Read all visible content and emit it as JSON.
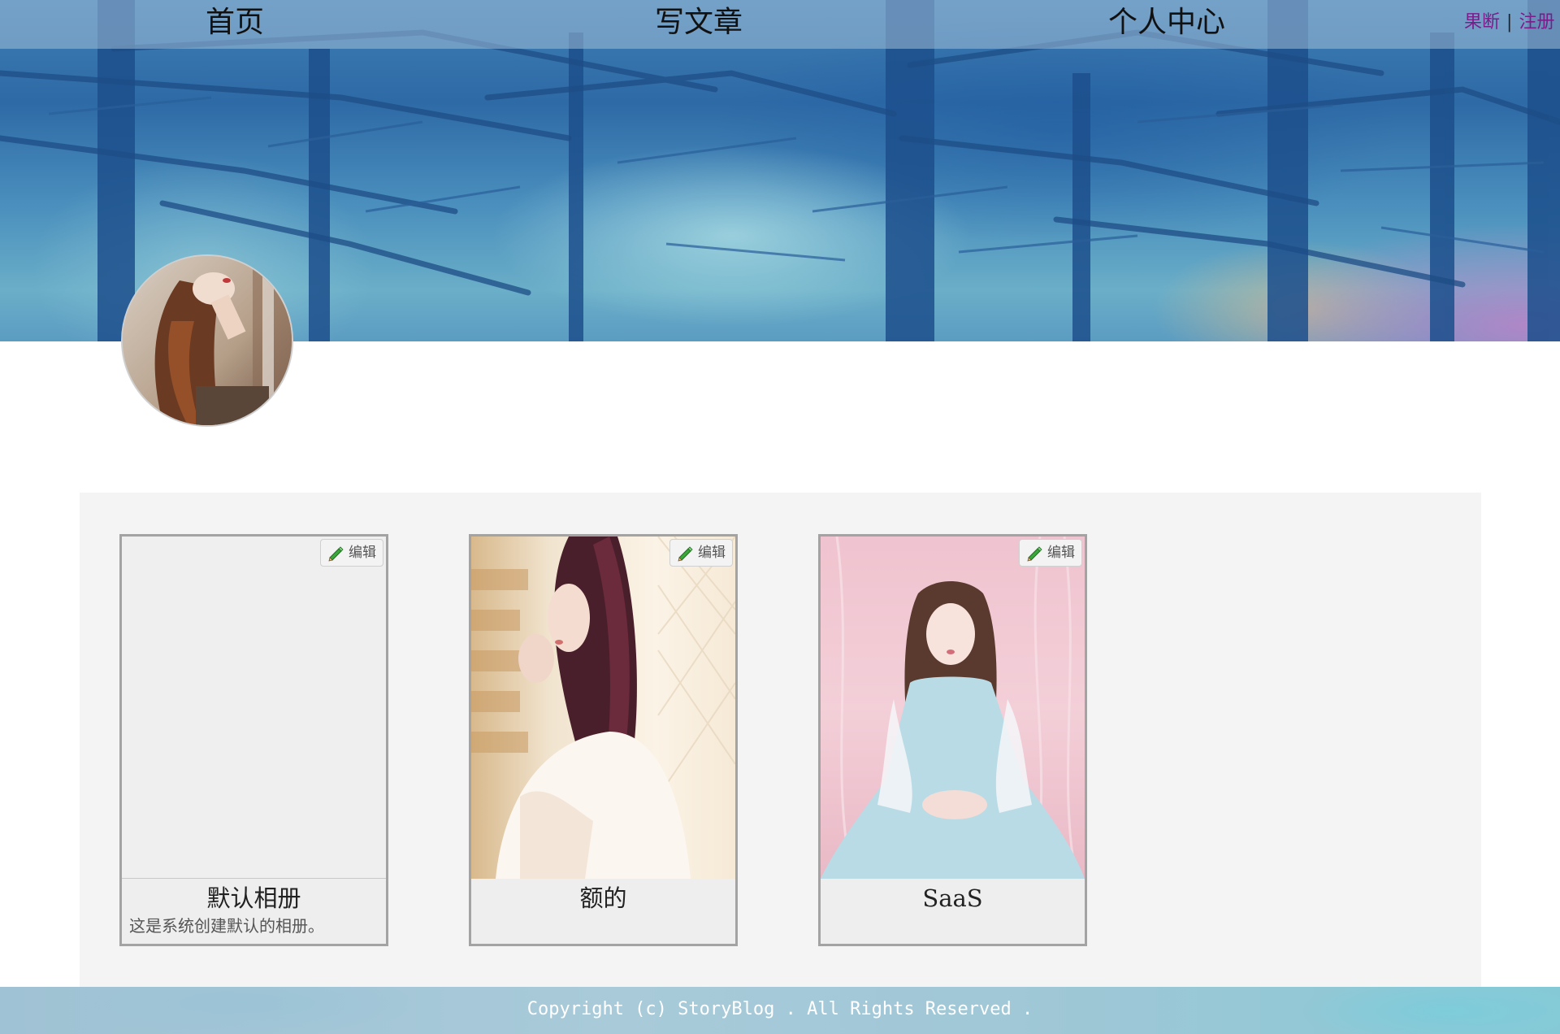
{
  "nav": {
    "home": "首页",
    "write": "写文章",
    "center": "个人中心"
  },
  "auth": {
    "login": "果断",
    "separator": "|",
    "register": "注册"
  },
  "albums": [
    {
      "title": "默认相册",
      "description": "这是系统创建默认的相册。",
      "edit_label": "编辑"
    },
    {
      "title": "额的",
      "description": "",
      "edit_label": "编辑"
    },
    {
      "title": "SaaS",
      "description": "",
      "edit_label": "编辑"
    }
  ],
  "footer": {
    "copyright": "Copyright (c) StoryBlog . All Rights Reserved ."
  },
  "colors": {
    "nav_bar": "#a0bed7",
    "auth_link": "#7a1d8a",
    "panel_bg": "#f4f4f4",
    "card_border": "#a3a3a3",
    "footer_bg": "#a8cad9"
  },
  "icons": {
    "edit": "pencil-icon"
  }
}
